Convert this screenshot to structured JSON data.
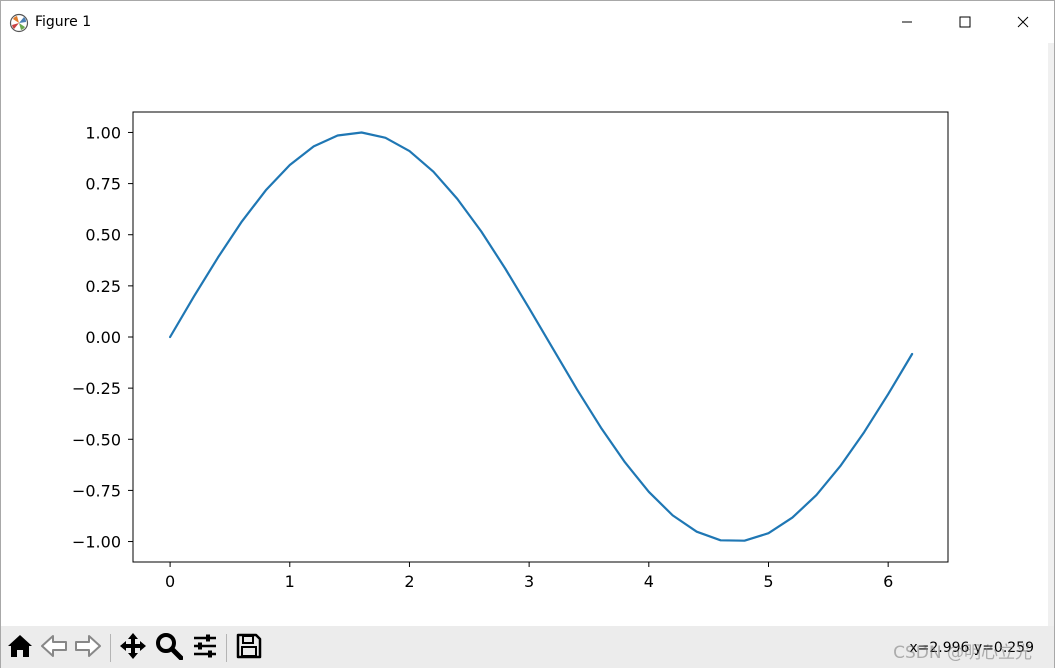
{
  "window": {
    "title": "Figure 1",
    "app_icon": "matplotlib-icon",
    "controls": [
      "minimize-icon",
      "maximize-icon",
      "close-icon"
    ]
  },
  "toolbar": {
    "buttons": [
      "home-icon",
      "back-icon",
      "forward-icon",
      "pan-icon",
      "zoom-icon",
      "configure-subplots-icon",
      "save-icon"
    ],
    "coords_text": "x=2.996 y=0.259",
    "watermark": "CSDN @明心立光"
  },
  "chart_data": {
    "type": "line",
    "title": "",
    "xlabel": "",
    "ylabel": "",
    "xlim": [
      -0.31,
      6.5
    ],
    "ylim": [
      -1.1,
      1.1
    ],
    "x_ticks": [
      0,
      1,
      2,
      3,
      4,
      5,
      6
    ],
    "x_tick_labels": [
      "0",
      "1",
      "2",
      "3",
      "4",
      "5",
      "6"
    ],
    "y_ticks": [
      1.0,
      0.75,
      0.5,
      0.25,
      0.0,
      -0.25,
      -0.5,
      -0.75,
      -1.0
    ],
    "y_tick_labels": [
      "1.00",
      "0.75",
      "0.50",
      "0.25",
      "0.00",
      "−0.25",
      "−0.50",
      "−0.75",
      "−1.00"
    ],
    "grid": false,
    "series": [
      {
        "color": "#1f77b4",
        "x": [
          0.0,
          0.2,
          0.4,
          0.6,
          0.8,
          1.0,
          1.2,
          1.4,
          1.6,
          1.8,
          2.0,
          2.2,
          2.4,
          2.6,
          2.8,
          3.0,
          3.2,
          3.4,
          3.6,
          3.8,
          4.0,
          4.2,
          4.4,
          4.6,
          4.8,
          5.0,
          5.2,
          5.4,
          5.6,
          5.8,
          6.0,
          6.2
        ],
        "y": [
          0.0,
          0.199,
          0.389,
          0.565,
          0.717,
          0.841,
          0.932,
          0.985,
          1.0,
          0.974,
          0.909,
          0.808,
          0.675,
          0.516,
          0.335,
          0.141,
          -0.058,
          -0.256,
          -0.443,
          -0.612,
          -0.757,
          -0.872,
          -0.952,
          -0.994,
          -0.996,
          -0.959,
          -0.883,
          -0.773,
          -0.631,
          -0.465,
          -0.279,
          -0.083
        ]
      }
    ]
  }
}
